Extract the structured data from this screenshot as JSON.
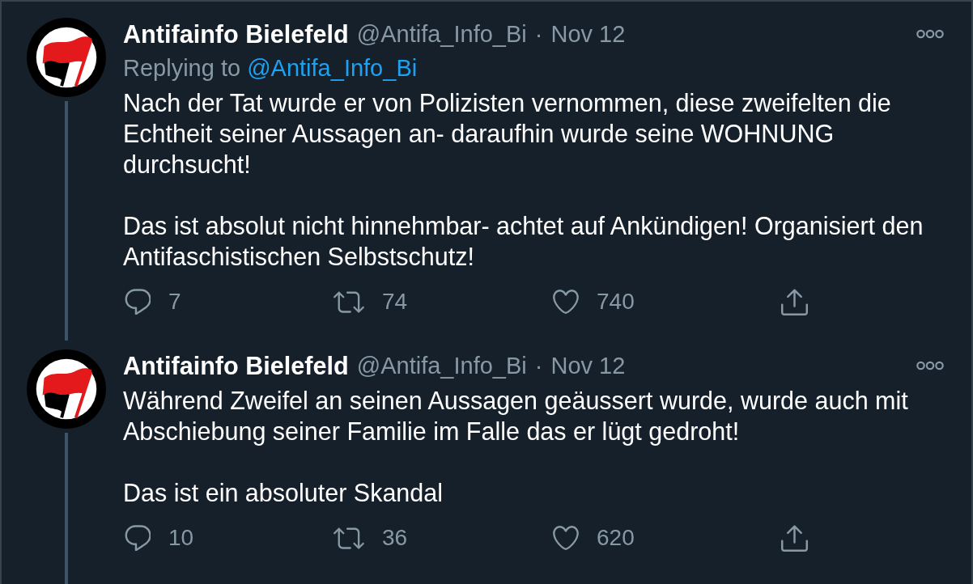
{
  "tweets": [
    {
      "author": {
        "name": "Antifainfo Bielefeld",
        "handle": "@Antifa_Info_Bi"
      },
      "separator": "·",
      "date": "Nov 12",
      "replying_to": {
        "label": "Replying to",
        "handle": "@Antifa_Info_Bi"
      },
      "text": "Nach der Tat wurde er von Polizisten vernommen, diese zweifelten die Echtheit seiner Aussagen an- daraufhin wurde seine WOHNUNG durchsucht!\n\nDas ist absolut nicht hinnehmbar- achtet auf Ankündigen! Organisiert den Antifaschistischen Selbstschutz!",
      "thread_line": true,
      "actions": [
        {
          "kind": "reply",
          "count": "7"
        },
        {
          "kind": "retweet",
          "count": "74"
        },
        {
          "kind": "like",
          "count": "740"
        },
        {
          "kind": "share"
        }
      ]
    },
    {
      "author": {
        "name": "Antifainfo Bielefeld",
        "handle": "@Antifa_Info_Bi"
      },
      "separator": "·",
      "date": "Nov 12",
      "text": "Während Zweifel an seinen Aussagen geäussert wurde, wurde auch mit Abschiebung seiner Familie im Falle das er lügt gedroht!\n\nDas ist ein absoluter Skandal",
      "thread_line": true,
      "actions": [
        {
          "kind": "reply",
          "count": "10"
        },
        {
          "kind": "retweet",
          "count": "36"
        },
        {
          "kind": "like",
          "count": "620"
        },
        {
          "kind": "share"
        }
      ]
    }
  ]
}
